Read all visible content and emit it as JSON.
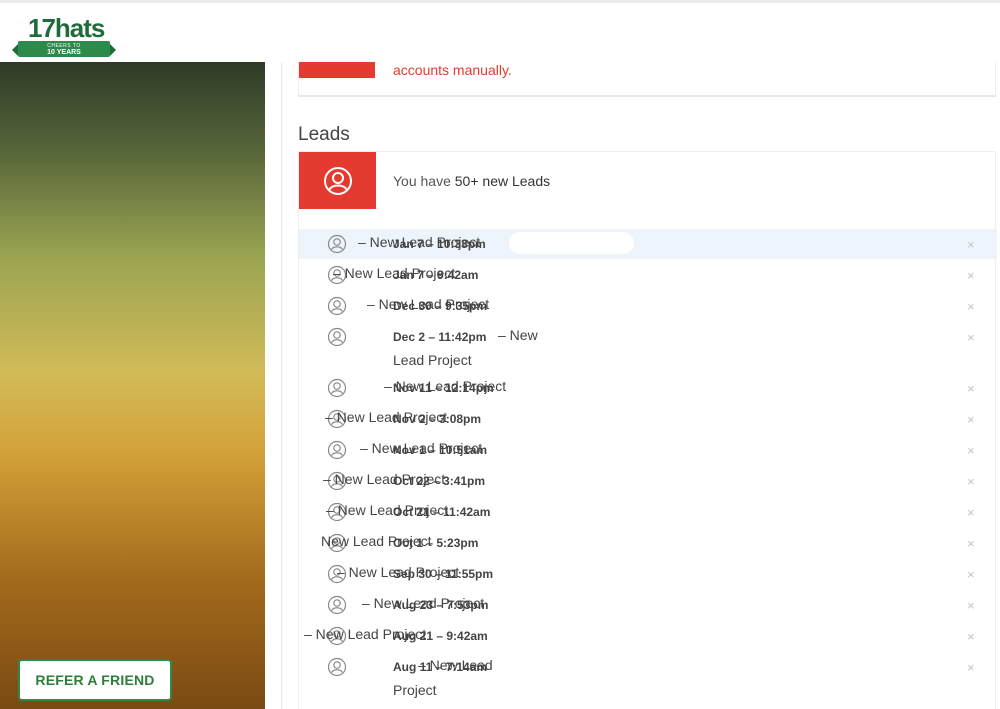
{
  "brand": {
    "logo_word": "17hats",
    "logo_tagline": "CHEERS TO",
    "logo_years": "10 YEARS",
    "green": "#2e8a4a",
    "red": "#e53a30"
  },
  "sidebar": {
    "refer_label": "REFER A FRIEND"
  },
  "alert": {
    "text": "accounts manually."
  },
  "leads": {
    "section_title": "Leads",
    "summary_prefix": "You have ",
    "summary_count": "50+ new Leads",
    "icon": "user-circle-icon",
    "close_icon": "×",
    "rows": [
      {
        "date": "Jan 7  –  10:33pm",
        "project": "–  New Lead Project",
        "cont": ""
      },
      {
        "date": "Jan 7  –  9:42am",
        "project": "–  New Lead Project",
        "cont": ""
      },
      {
        "date": "Dec 30  –  9:35pm",
        "project": "–  New Lead Project",
        "cont": ""
      },
      {
        "date": "Dec 2  –  11:42pm",
        "project": "–  New",
        "cont": "Lead Project"
      },
      {
        "date": "Nov 11  –  12:14pm",
        "project": "–  New Lead Project",
        "cont": ""
      },
      {
        "date": "Nov 2  –  3:08pm",
        "project": "–  New Lead Project",
        "cont": ""
      },
      {
        "date": "Nov 1  –  10:51am",
        "project": "–  New Lead Project",
        "cont": ""
      },
      {
        "date": "Oct 22  –  3:41pm",
        "project": "–  New Lead Project",
        "cont": ""
      },
      {
        "date": "Oct 21  –  11:42am",
        "project": "–  New Lead Project",
        "cont": ""
      },
      {
        "date": "Oct 1  –  5:23pm",
        "project": "New Lead Project",
        "cont": ""
      },
      {
        "date": "Sep 30  –  11:55pm",
        "project": "–  New Lead Project",
        "cont": ""
      },
      {
        "date": "Aug 23  –  7:53pm",
        "project": "–  New Lead Project",
        "cont": ""
      },
      {
        "date": "Aug 21  –  9:42am",
        "project": "–  New Lead Project",
        "cont": ""
      },
      {
        "date": "Aug 11  –  7:14am",
        "project": "–  New Lead",
        "cont": "Project"
      }
    ]
  }
}
